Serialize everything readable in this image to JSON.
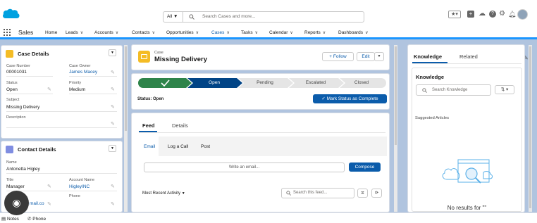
{
  "header": {
    "search_scope": "All",
    "search_placeholder": "Search Cases and more..."
  },
  "nav": {
    "app_name": "Sales",
    "items": [
      "Home",
      "Leads",
      "Accounts",
      "Contacts",
      "Opportunities",
      "Cases",
      "Tasks",
      "Calendar",
      "Reports",
      "Dashboards"
    ]
  },
  "case_details": {
    "title": "Case Details",
    "fields": {
      "case_number_label": "Case Number",
      "case_number": "00001031",
      "owner_label": "Case Owner",
      "owner": "James Macey",
      "status_label": "Status",
      "status": "Open",
      "priority_label": "Priority",
      "priority": "Medium",
      "subject_label": "Subject",
      "subject": "Missing Delivery",
      "description_label": "Description"
    }
  },
  "contact_details": {
    "title": "Contact Details",
    "fields": {
      "name_label": "Name",
      "name": "Antonetta Higley",
      "title_label": "Title",
      "title": "Manager",
      "account_label": "Account Name",
      "account": "HigleyINC",
      "email_partial": "mail.co",
      "phone_label": "Phone"
    }
  },
  "record": {
    "object": "Case",
    "name": "Missing Delivery",
    "follow_label": "+ Follow",
    "edit_label": "Edit"
  },
  "path": {
    "stages": [
      "Open",
      "Pending",
      "Escalated",
      "Closed"
    ],
    "status_text": "Status: Open",
    "mark_complete_label": "Mark Status as Complete"
  },
  "feed": {
    "tabs": [
      "Feed",
      "Details"
    ],
    "publisher_tabs": [
      "Email",
      "Log a Call",
      "Post"
    ],
    "write_placeholder": "Write an email...",
    "compose_label": "Compose",
    "sort_label": "Most Recent Activity",
    "search_placeholder": "Search this feed..."
  },
  "knowledge": {
    "tabs": [
      "Knowledge",
      "Related"
    ],
    "title": "Knowledge",
    "search_placeholder": "Search Knowledge",
    "suggested": "Suggested Articles",
    "empty": "No results for \"\""
  },
  "utility": {
    "notes": "Notes",
    "phone": "Phone"
  },
  "colors": {
    "brand": "#0b5cab",
    "path_complete": "#2e844a",
    "path_current": "#014486",
    "accent": "#1b96ff"
  }
}
